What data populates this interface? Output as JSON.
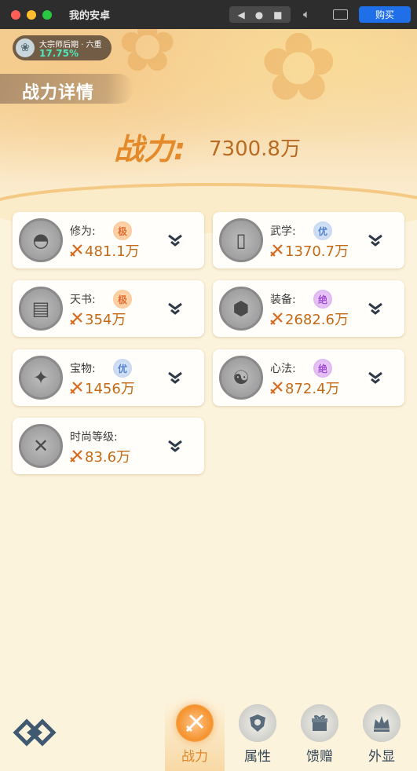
{
  "window": {
    "title": "我的安卓",
    "buy_label": "购买"
  },
  "rank": {
    "name": "大宗师后期 · 六重",
    "percent": "17.75%"
  },
  "page": {
    "title": "战力详情",
    "power_label": "战力:",
    "power_value": "7300.8万"
  },
  "cards": [
    {
      "label": "修为:",
      "grade": "极",
      "grade_color": "orange",
      "value": "481.1万",
      "icon": "hat-icon"
    },
    {
      "label": "武学:",
      "grade": "优",
      "grade_color": "blue",
      "value": "1370.7万",
      "icon": "book-icon"
    },
    {
      "label": "天书:",
      "grade": "极",
      "grade_color": "orange",
      "value": "354万",
      "icon": "scroll-book-icon"
    },
    {
      "label": "装备:",
      "grade": "绝",
      "grade_color": "purple",
      "value": "2682.6万",
      "icon": "equipment-box-icon"
    },
    {
      "label": "宝物:",
      "grade": "优",
      "grade_color": "blue",
      "value": "1456万",
      "icon": "treasure-pot-icon"
    },
    {
      "label": "心法:",
      "grade": "绝",
      "grade_color": "purple",
      "value": "872.4万",
      "icon": "meditation-icon"
    },
    {
      "label": "时尚等级:",
      "grade": "",
      "grade_color": "",
      "value": "83.6万",
      "icon": "fashion-icon"
    }
  ],
  "tabs": [
    {
      "label": "战力",
      "active": true,
      "icon": "swords-icon"
    },
    {
      "label": "属性",
      "active": false,
      "icon": "shield-icon"
    },
    {
      "label": "馈赠",
      "active": false,
      "icon": "gift-icon"
    },
    {
      "label": "外显",
      "active": false,
      "icon": "crown-icon"
    }
  ],
  "colors": {
    "accent": "#e58a2a",
    "value_text": "#c46a16",
    "grade_orange": "#e6692b",
    "grade_blue": "#4f7fcf",
    "grade_purple": "#a14bd3",
    "buy_button": "#1f6fe8"
  }
}
